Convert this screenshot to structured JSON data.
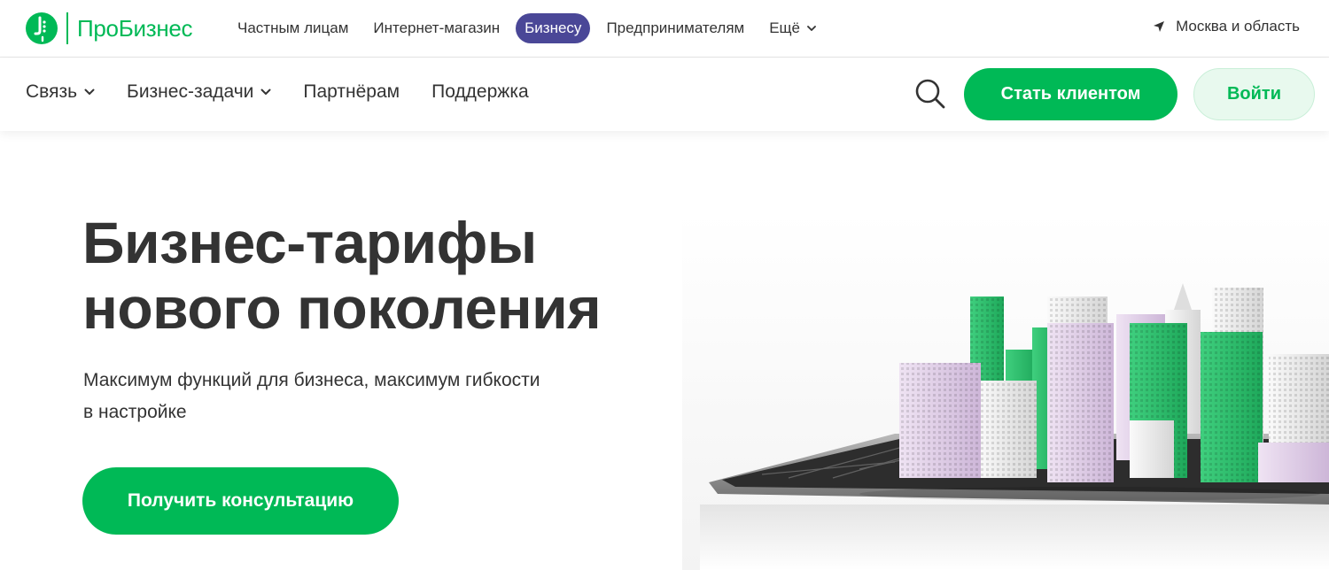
{
  "brand": {
    "name": "ПроБизнес",
    "color": "#00b956"
  },
  "top_nav": {
    "items": [
      "Частным лицам",
      "Интернет-магазин",
      "Бизнесу",
      "Предпринимателям"
    ],
    "active": "Бизнесу",
    "more_label": "Ещё",
    "active_color": "#4a4797"
  },
  "region": {
    "label": "Москва и область",
    "icon": "location-arrow-icon"
  },
  "main_nav": {
    "links": [
      {
        "label": "Связь",
        "has_dropdown": true
      },
      {
        "label": "Бизнес-задачи",
        "has_dropdown": true
      },
      {
        "label": "Партнёрам",
        "has_dropdown": false
      },
      {
        "label": "Поддержка",
        "has_dropdown": false
      }
    ],
    "search_icon": "search-icon",
    "become_client_label": "Стать клиентом",
    "login_label": "Войти"
  },
  "hero": {
    "title_line1": "Бизнес-тарифы",
    "title_line2": "нового поколения",
    "subtitle_line1": "Максимум функций для бизнеса, максимум гибкости",
    "subtitle_line2": "в настройке",
    "cta_label": "Получить консультацию",
    "image": "city-buildings-on-tablet-illustration"
  }
}
